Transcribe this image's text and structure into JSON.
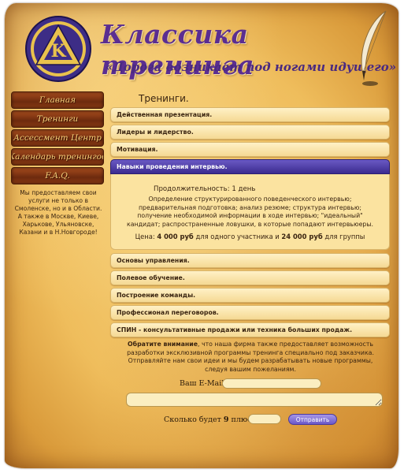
{
  "header": {
    "title": "Классика тренинга",
    "slogan": "«Дорога возникает под ногами идущего»",
    "logo_icon": "triangle-in-circle-logo-icon",
    "quill_icon": "quill-pen-icon"
  },
  "nav": {
    "items": [
      {
        "label": "Главная"
      },
      {
        "label": "Тренинги"
      },
      {
        "label": "Ассессмент Центр"
      },
      {
        "label": "Календарь тренингов"
      },
      {
        "label": "F.A.Q."
      }
    ],
    "info": "Мы предоставляем свои услуги не только в Смоленске, но и в Области. А также в Москве, Киеве, Харькове, Ульяновске, Казани и в Н.Новгороде!"
  },
  "main": {
    "title": "Тренинги.",
    "trainings_before": [
      {
        "label": "Действенная презентация."
      },
      {
        "label": "Лидеры и лидерство."
      },
      {
        "label": "Мотивация."
      }
    ],
    "active": {
      "label": "Навыки проведения интервью.",
      "duration": "Продолжительность: 1 день",
      "description": "Определение структурированного поведенческого интервью; предварительная подготовка; анализ резюме; структура интервью; получение необходимой информации в ходе интервью; \"идеальный\" кандидат; распространенные ловушки, в которые попадают интервьюеры.",
      "price_prefix": "Цена: ",
      "price_single": "4 000 руб",
      "price_middle": " для одного участника и ",
      "price_group": "24 000 руб",
      "price_suffix": " для группы"
    },
    "trainings_after": [
      {
        "label": "Основы управления."
      },
      {
        "label": "Полевое обучение."
      },
      {
        "label": "Построение команды."
      },
      {
        "label": "Профессионал переговоров."
      },
      {
        "label": "СПИН - консультативные продажи или техника больших продаж."
      }
    ]
  },
  "notice": {
    "bold": "Обратите внимание",
    "text": ", что наша фирма также предоставляет возможность разработки эксклюзивной программы тренинга специально под заказчика. Отправляйте нам свои идеи и мы будем разрабатывать новые программы, следуя вашим пожеланиям."
  },
  "form": {
    "email_label": "Ваш E-Mail:",
    "email_value": "",
    "message_value": "",
    "captcha_prefix": "Сколько будет ",
    "captcha_a": "9",
    "captcha_mid": " плюс ",
    "captcha_b": "6",
    "captcha_suffix": "?",
    "captcha_value": "",
    "submit_label": "Отправить"
  },
  "colors": {
    "title_purple": "#5b2e91",
    "active_tab": "#4a3aa3",
    "nav_brown": "#7a3312",
    "parchment": "#efbd5c"
  }
}
